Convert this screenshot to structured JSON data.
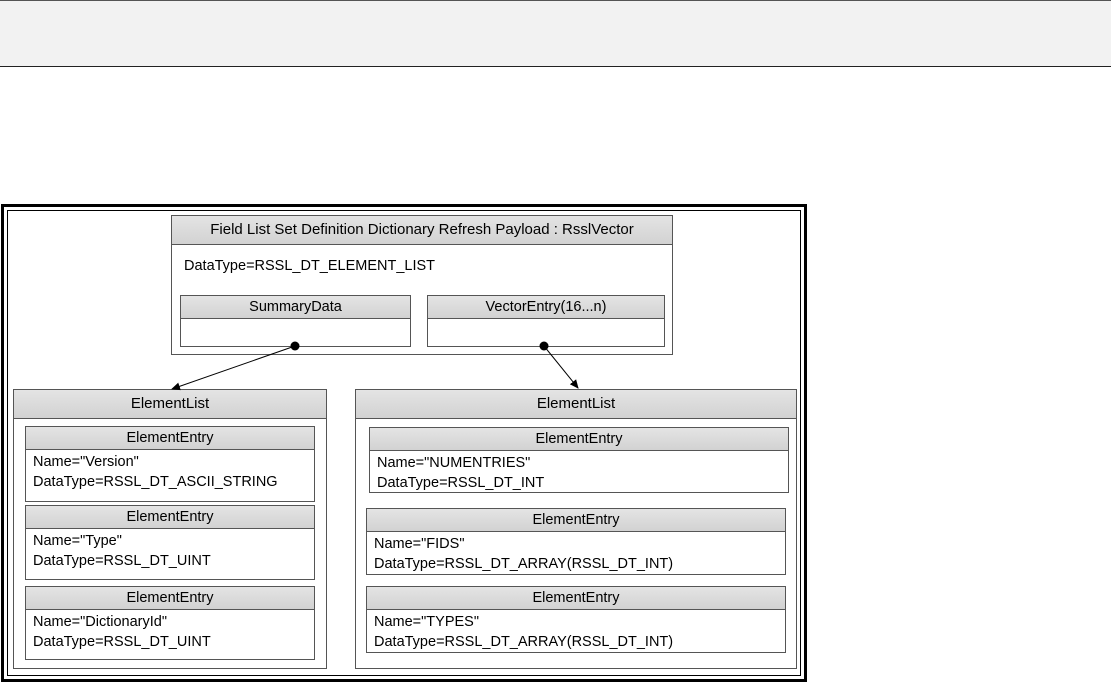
{
  "vector": {
    "title": "Field List Set Definition Dictionary Refresh Payload : RsslVector",
    "datatype": "DataType=RSSL_DT_ELEMENT_LIST",
    "summary_label": "SummaryData",
    "vector_entry_label": "VectorEntry(16...n)"
  },
  "left_list": {
    "title": "ElementList",
    "entries": [
      {
        "header": "ElementEntry",
        "name": "Name=\"Version\"",
        "datatype": "DataType=RSSL_DT_ASCII_STRING"
      },
      {
        "header": "ElementEntry",
        "name": "Name=\"Type\"",
        "datatype": "DataType=RSSL_DT_UINT"
      },
      {
        "header": "ElementEntry",
        "name": "Name=\"DictionaryId\"",
        "datatype": "DataType=RSSL_DT_UINT"
      }
    ]
  },
  "right_list": {
    "title": "ElementList",
    "entries": [
      {
        "header": "ElementEntry",
        "name": "Name=\"NUMENTRIES\"",
        "datatype": "DataType=RSSL_DT_INT"
      },
      {
        "header": "ElementEntry",
        "name": "Name=\"FIDS\"",
        "datatype": "DataType=RSSL_DT_ARRAY(RSSL_DT_INT)"
      },
      {
        "header": "ElementEntry",
        "name": "Name=\"TYPES\"",
        "datatype": "DataType=RSSL_DT_ARRAY(RSSL_DT_INT)"
      }
    ]
  }
}
